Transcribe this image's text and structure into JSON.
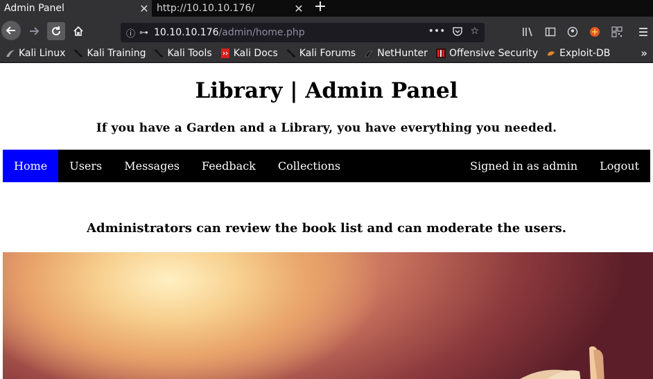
{
  "browser": {
    "tabs": [
      {
        "title": "Admin Panel",
        "active": true
      },
      {
        "title": "http://10.10.10.176/",
        "active": false
      }
    ],
    "url": {
      "host": "10.10.10.176",
      "path": "/admin/home.php"
    },
    "bookmarks": [
      {
        "label": "Kali Linux",
        "icon": "kali-dragon-icon"
      },
      {
        "label": "Kali Training",
        "icon": "kali-dragon-icon"
      },
      {
        "label": "Kali Tools",
        "icon": "kali-dragon-icon"
      },
      {
        "label": "Kali Docs",
        "icon": "docs-icon"
      },
      {
        "label": "Kali Forums",
        "icon": "kali-dragon-icon"
      },
      {
        "label": "NetHunter",
        "icon": "nethunter-icon"
      },
      {
        "label": "Offensive Security",
        "icon": "offsec-icon"
      },
      {
        "label": "Exploit-DB",
        "icon": "exploitdb-icon"
      }
    ],
    "colors": {
      "chrome_dark": "#0c0c0d",
      "chrome": "#323234",
      "urlbar": "#1c1b22"
    }
  },
  "page": {
    "title": "Library | Admin Panel",
    "tagline": "If you have a Garden and a Library, you have everything you needed.",
    "nav": {
      "items": [
        "Home",
        "Users",
        "Messages",
        "Feedback",
        "Collections"
      ],
      "active": "Home",
      "signed_in": "Signed in as admin",
      "logout": "Logout",
      "active_color": "#0000ff"
    },
    "notice": "Administrators can review the book list and can moderate the users."
  }
}
